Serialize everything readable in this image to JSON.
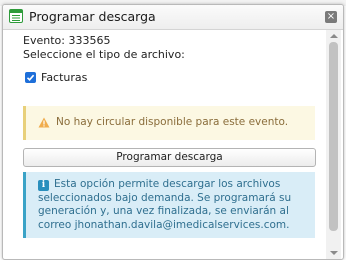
{
  "dialog": {
    "title": "Programar descarga",
    "close_glyph": "×",
    "icon": "spreadsheet-icon"
  },
  "event": {
    "text": "Evento: 333565"
  },
  "file_type": {
    "heading": "Seleccione el tipo de archivo:",
    "options": [
      {
        "label": "Facturas",
        "checked": true
      }
    ]
  },
  "warning": {
    "icon": "warning-icon",
    "text": "No hay circular disponible para este evento.",
    "color": "#8a6d3b",
    "background": "#fcf8e3"
  },
  "actions": {
    "schedule_label": "Programar descarga"
  },
  "info": {
    "icon": "info-icon",
    "icon_glyph": "i",
    "text": "Esta opción permite descargar los archivos seleccionados bajo demanda. Se programará su generación y, una vez finalizada, se enviarán al correo jhonathan.davila@imedicalservices.com.",
    "color": "#2f6f8f",
    "background": "#d9edf7"
  },
  "colors": {
    "checkbox_accent": "#1e6fd9",
    "icon_green": "#2e9b3a"
  }
}
